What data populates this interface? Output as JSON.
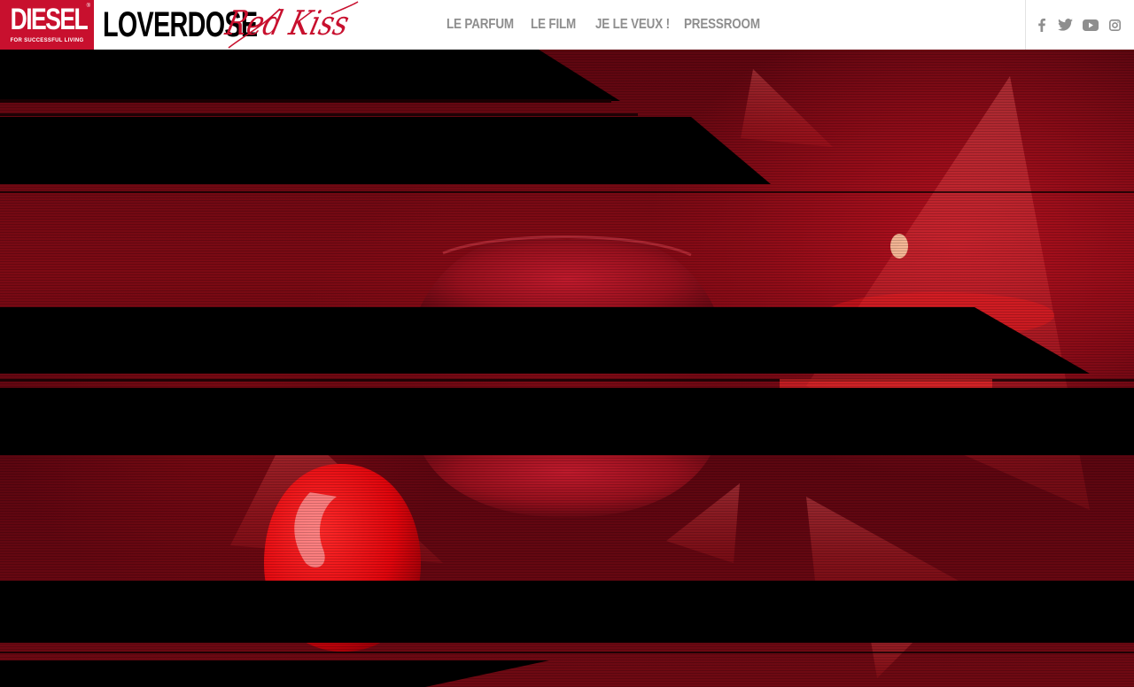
{
  "header": {
    "brand": {
      "name": "DIESEL",
      "tagline": "FOR SUCCESSFUL LIVING",
      "reg": "®"
    },
    "product": {
      "name": "LOVERDOSE",
      "script": "Red Kiss"
    },
    "nav": [
      {
        "label": "LE PARFUM"
      },
      {
        "label": "LE FILM"
      },
      {
        "label": "JE LE VEUX !"
      },
      {
        "label": "PRESSROOM"
      }
    ],
    "social": [
      "facebook-icon",
      "twitter-icon",
      "youtube-icon",
      "instagram-icon"
    ]
  },
  "colors": {
    "brand_red": "#c8102e",
    "nav_text": "#8e8e8e",
    "header_bg": "#ffffff"
  }
}
